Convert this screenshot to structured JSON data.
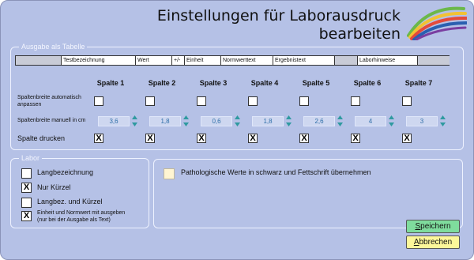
{
  "title_line1": "Einstellungen für Laborausdruck",
  "title_line2": "bearbeiten",
  "table_section": {
    "legend": "Ausgabe als Tabelle",
    "header_cells": [
      "",
      "Testbezeichnung",
      "Wert",
      "+/-",
      "Einheit",
      "Normwerttext",
      "Ergebnistext",
      "",
      "Laborhinweise",
      ""
    ],
    "columns": [
      "Spalte 1",
      "Spalte 2",
      "Spalte 3",
      "Spalte 4",
      "Spalte 5",
      "Spalte 6",
      "Spalte 7"
    ],
    "auto_width_label": "Spaltenbreite automatisch anpassen",
    "manual_width_label": "Spaltenbreite manuell in  cm",
    "print_label": "Spalte drucken",
    "auto_width_checked": [
      false,
      false,
      false,
      false,
      false,
      false,
      false
    ],
    "widths": [
      "3,6",
      "1,8",
      "0,6",
      "1,8",
      "2,6",
      "4",
      "3"
    ],
    "print_checked": [
      "X",
      "X",
      "X",
      "X",
      "X",
      "X",
      "X"
    ]
  },
  "labor_section": {
    "legend": "Labor",
    "options": [
      {
        "label": "Langbezeichnung",
        "mark": ""
      },
      {
        "label": "Nur Kürzel",
        "mark": "X"
      },
      {
        "label": "Langbez. und Kürzel",
        "mark": ""
      }
    ],
    "norm_option": {
      "line1": "Einheit und Normwert mit ausgeben",
      "line2": "(nur bei der Ausgabe als Text)",
      "mark": "X"
    }
  },
  "patho_label": "Pathologische Werte in schwarz und Fettschrift übernehmen",
  "buttons": {
    "save": "Speichern",
    "cancel": "Abbrechen"
  },
  "colors": {
    "background": "#b5c1e6",
    "save": "#7fdc9d",
    "cancel": "#fcf79a",
    "spin_text": "#2f6fa8",
    "spin_arrow": "#2f9aa0"
  },
  "logo_icon": "rainbow-swoosh-logo"
}
